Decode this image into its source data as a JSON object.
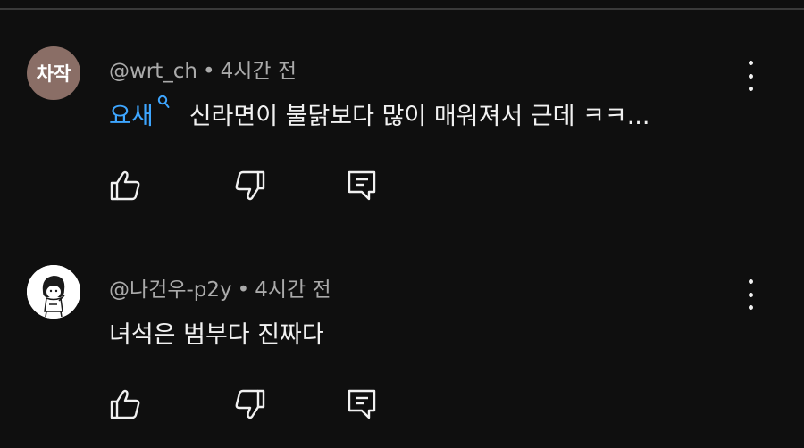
{
  "comments": [
    {
      "avatar_text": "차작",
      "author": "@wrt_ch",
      "separator": "•",
      "time": "4시간 전",
      "mention": "요새",
      "mention_icon": "search-icon",
      "text": "신라면이 불닭보다 많이 매워져서 근데 ㅋㅋ...",
      "avatar_color": "#8a6e66"
    },
    {
      "avatar_text": "",
      "author": "@나건우-p2y",
      "separator": "•",
      "time": "4시간 전",
      "mention": "",
      "text": "녀석은 범부다 진짜다"
    }
  ],
  "colors": {
    "background": "#0f0f0f",
    "mention": "#3ea6ff",
    "meta": "#aaaaaa"
  }
}
